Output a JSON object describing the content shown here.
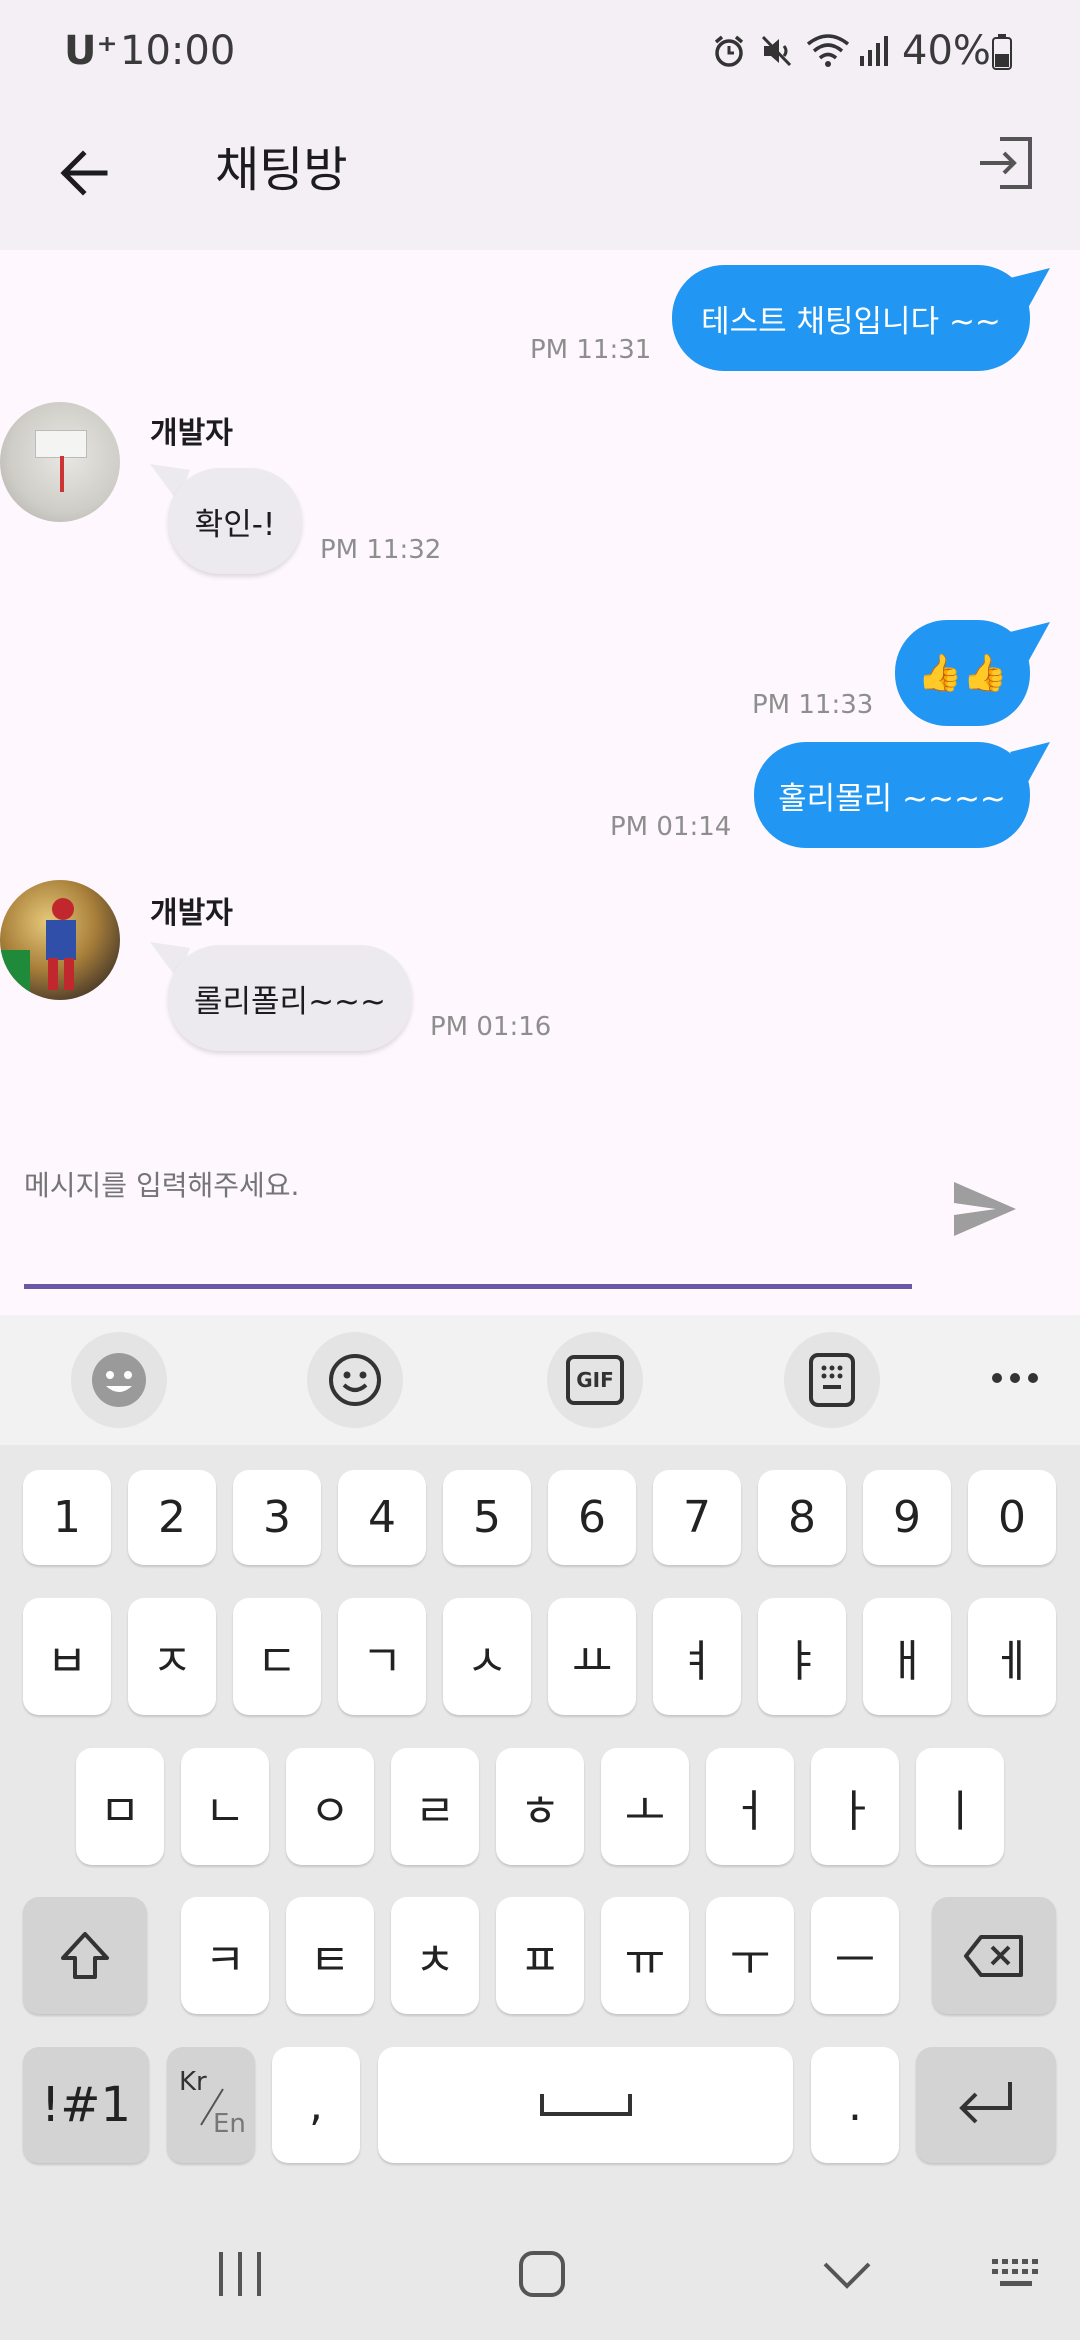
{
  "status_bar": {
    "carrier": "U⁺",
    "time": "10:00",
    "battery": "40%"
  },
  "app_bar": {
    "title": "채팅방"
  },
  "messages": [
    {
      "side": "me",
      "text": "테스트 채팅입니다 ~~",
      "time": "PM 11:31"
    },
    {
      "side": "other",
      "sender": "개발자",
      "text": "확인-!",
      "time": "PM 11:32"
    },
    {
      "side": "me",
      "text": "👍👍",
      "time": "PM 11:33"
    },
    {
      "side": "me",
      "text": "홀리몰리 ~~~~",
      "time": "PM 01:14"
    },
    {
      "side": "other",
      "sender": "개발자",
      "text": "롤리폴리~~~",
      "time": "PM 01:16"
    }
  ],
  "input": {
    "placeholder": "메시지를 입력해주세요."
  },
  "keyboard": {
    "numbers": [
      "1",
      "2",
      "3",
      "4",
      "5",
      "6",
      "7",
      "8",
      "9",
      "0"
    ],
    "row1": [
      "ㅂ",
      "ㅈ",
      "ㄷ",
      "ㄱ",
      "ㅅ",
      "ㅛ",
      "ㅕ",
      "ㅑ",
      "ㅐ",
      "ㅔ"
    ],
    "row2": [
      "ㅁ",
      "ㄴ",
      "ㅇ",
      "ㄹ",
      "ㅎ",
      "ㅗ",
      "ㅓ",
      "ㅏ",
      "ㅣ"
    ],
    "row3": [
      "ㅋ",
      "ㅌ",
      "ㅊ",
      "ㅍ",
      "ㅠ",
      "ㅜ",
      "ㅡ"
    ],
    "symbols_label": "!#1",
    "lang_top": "Kr",
    "lang_bottom": "En",
    "comma": ",",
    "period": ".",
    "gif_label": "GIF"
  },
  "colors": {
    "accent": "#2196f3",
    "input_underline": "#6b57a8",
    "placeholder": "#6b57a8"
  }
}
